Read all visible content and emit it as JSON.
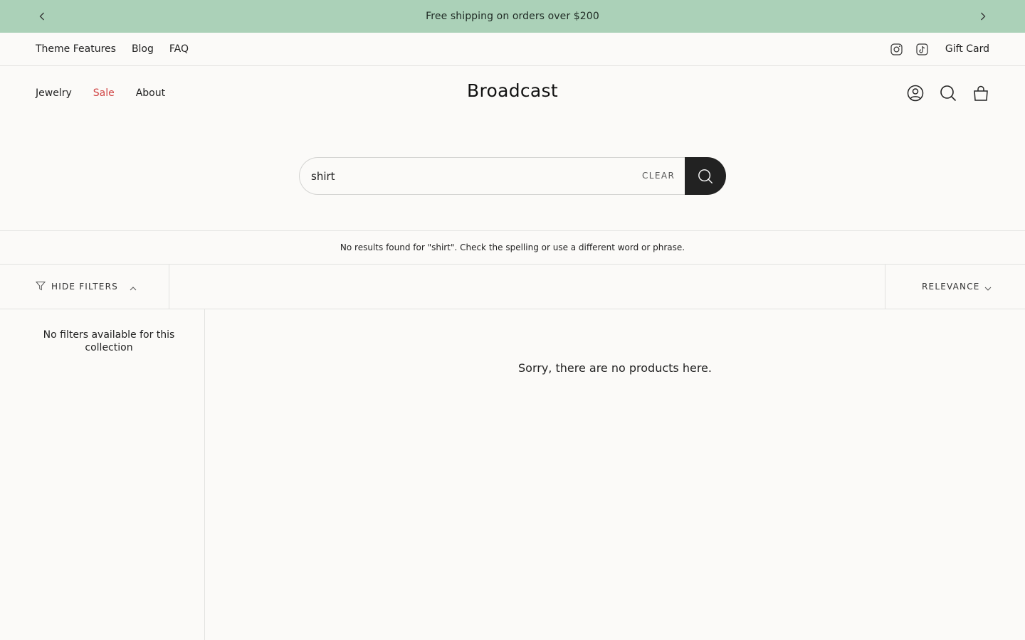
{
  "announcement": {
    "text": "Free shipping on orders over $200",
    "prev_icon": "chevron-left-icon",
    "next_icon": "chevron-right-icon"
  },
  "utility_nav": {
    "links": [
      "Theme Features",
      "Blog",
      "FAQ"
    ],
    "social_icons": [
      "instagram-icon",
      "tiktok-icon"
    ],
    "gift_card": "Gift Card"
  },
  "header": {
    "logo": "Broadcast",
    "nav": [
      "Jewelry",
      "Sale",
      "About"
    ],
    "icons": [
      "account-icon",
      "search-icon",
      "cart-bag-icon"
    ]
  },
  "search": {
    "value": "shirt",
    "clear_label": "CLEAR",
    "submit_icon": "search-icon"
  },
  "results": {
    "message": "No results found for \"shirt\". Check the spelling or use a different word or phrase."
  },
  "toolbar": {
    "hide_filters": "HIDE FILTERS",
    "sort_label": "RELEVANCE"
  },
  "sidebar": {
    "empty_message": "No filters available for this collection"
  },
  "products": {
    "empty_message": "Sorry, there are no products here."
  },
  "colors": {
    "announcement_bg": "#abd1b8",
    "sale": "#d04343",
    "page_bg": "#fbfaf8",
    "button_dark": "#222222"
  }
}
